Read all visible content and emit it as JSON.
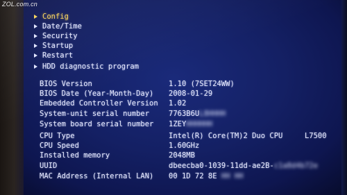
{
  "watermark": "ZOL.com.cn",
  "menu": {
    "items": [
      {
        "label": "Config",
        "selected": true
      },
      {
        "label": "Date/Time",
        "selected": false
      },
      {
        "label": "Security",
        "selected": false
      },
      {
        "label": "Startup",
        "selected": false
      },
      {
        "label": "Restart",
        "selected": false
      },
      {
        "label": "HDD diagnostic program",
        "selected": false
      }
    ]
  },
  "info": {
    "rows": [
      {
        "label": "BIOS Version",
        "value": "1.10  (7SET24WW)",
        "hidden": ""
      },
      {
        "label": "BIOS Date (Year-Month-Day)",
        "value": "2008-01-29",
        "hidden": ""
      },
      {
        "label": "Embedded Controller Version",
        "value": "1.02",
        "hidden": ""
      },
      {
        "label": "System-unit serial number",
        "value": "7763B6U",
        "hidden": "L8HHHH"
      },
      {
        "label": "System board serial number",
        "value": "1ZEY",
        "hidden": "HHHHHH"
      },
      {
        "label": "CPU Type",
        "value": "Intel(R) Core(TM)2 Duo CPU     L7500",
        "hidden": ""
      },
      {
        "label": "CPU Speed",
        "value": "1.60GHz",
        "hidden": ""
      },
      {
        "label": "Installed memory",
        "value": "2048MB",
        "hidden": ""
      },
      {
        "label": "UUID",
        "value": "dbeecba0-1039-11dd-ae2B-",
        "hidden": "c1a8d4b72e"
      },
      {
        "label": "MAC Address (Internal LAN)",
        "value": "00 1D 72 8E",
        "hidden": "HH HH"
      }
    ]
  }
}
